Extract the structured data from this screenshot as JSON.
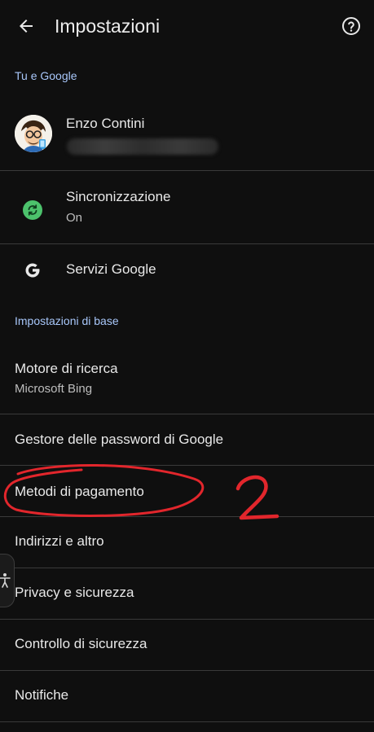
{
  "header": {
    "title": "Impostazioni"
  },
  "sections": {
    "account": "Tu e Google",
    "basic": "Impostazioni di base"
  },
  "account": {
    "name": "Enzo Contini"
  },
  "sync": {
    "title": "Sincronizzazione",
    "status": "On",
    "color": "#4cc26c"
  },
  "google_services": {
    "title": "Servizi Google"
  },
  "search_engine": {
    "title": "Motore di ricerca",
    "value": "Microsoft Bing"
  },
  "items": {
    "password_manager": "Gestore delle password di Google",
    "payment_methods": "Metodi di pagamento",
    "addresses": "Indirizzi e altro",
    "privacy": "Privacy e sicurezza",
    "safety_check": "Controllo di sicurezza",
    "notifications": "Notifiche"
  },
  "annotation": {
    "number": "2",
    "color": "#e2262c"
  },
  "colors": {
    "background": "#0f0f0f",
    "section_label": "#a8c7fa",
    "divider": "#3a3a3a"
  }
}
